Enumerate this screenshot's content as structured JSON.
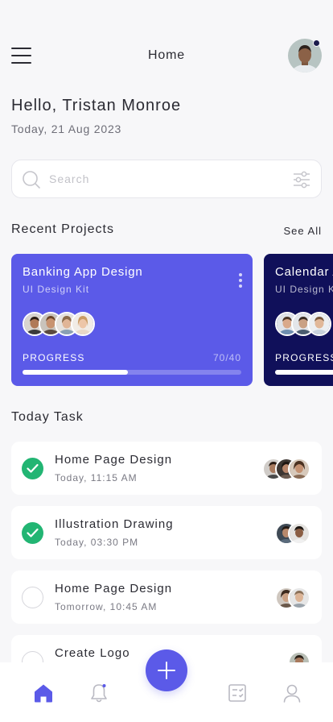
{
  "header": {
    "title": "Home",
    "menu_icon": "hamburger-menu-icon",
    "avatar_icon": "user-avatar"
  },
  "greeting": "Hello, Tristan Monroe",
  "date": "Today, 21 Aug 2023",
  "search": {
    "placeholder": "Search",
    "value": "",
    "search_icon": "search-icon",
    "filter_icon": "filter-sliders-icon"
  },
  "recent_projects": {
    "title": "Recent Projects",
    "see_all_label": "See All",
    "cards": [
      {
        "title": "Banking App Design",
        "subtitle": "UI Design Kit",
        "progress_label": "PROGRESS",
        "progress_value": "70/40",
        "progress_fraction": 0.48,
        "color": "#5b5ae8",
        "members": 4
      },
      {
        "title": "Calendar App",
        "subtitle": "UI Design Kit",
        "progress_label": "PROGRESS",
        "progress_value": "",
        "progress_fraction": 0.6,
        "color": "#10105a",
        "members": 3
      }
    ]
  },
  "today_task": {
    "title": "Today Task",
    "tasks": [
      {
        "title": "Home Page Design",
        "time": "Today, 11:15 AM",
        "done": true,
        "members": 3
      },
      {
        "title": "Illustration Drawing",
        "time": "Today, 03:30 PM",
        "done": true,
        "members": 2
      },
      {
        "title": "Home Page Design",
        "time": "Tomorrow, 10:45 AM",
        "done": false,
        "members": 2
      },
      {
        "title": "Create Logo",
        "time": "",
        "done": false,
        "members": 1
      }
    ]
  },
  "bottom_nav": {
    "items": [
      "home-icon",
      "bell-icon",
      "add-icon",
      "task-list-icon",
      "profile-icon"
    ],
    "active": "home-icon",
    "accent": "#5b5ae8",
    "inactive_color": "#b9b9c2"
  }
}
